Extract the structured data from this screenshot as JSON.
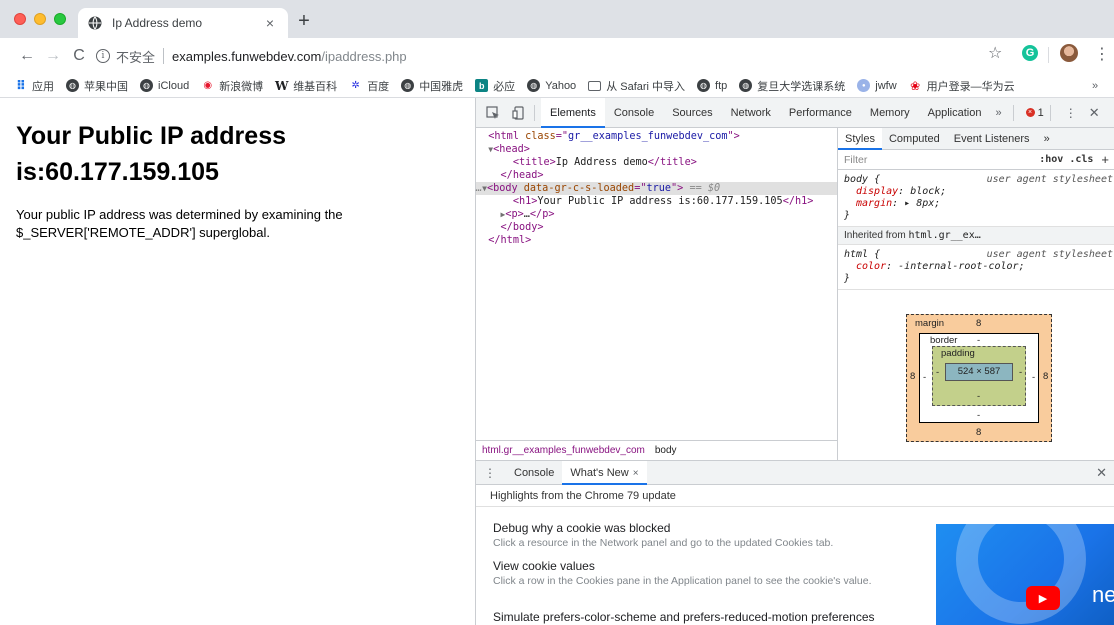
{
  "tab": {
    "title": "Ip Address demo",
    "close": "×",
    "new_tab": "+"
  },
  "toolbar": {
    "back": "←",
    "forward": "→",
    "reload": "C",
    "security_label": "不安全",
    "url_host": "examples.funwebdev.com",
    "url_path": "/ipaddress.php",
    "star": "☆",
    "extension": "G",
    "menu": "⋮"
  },
  "bookmarks": {
    "items": [
      {
        "label": "应用",
        "icon": "apps-icon"
      },
      {
        "label": "苹果中国",
        "icon": "globe-icon"
      },
      {
        "label": "iCloud",
        "icon": "globe-icon"
      },
      {
        "label": "新浪微博",
        "icon": "weibo-icon"
      },
      {
        "label": "维基百科",
        "icon": "wikipedia-icon"
      },
      {
        "label": "百度",
        "icon": "baidu-icon"
      },
      {
        "label": "中国雅虎",
        "icon": "globe-icon"
      },
      {
        "label": "必应",
        "icon": "bing-icon"
      },
      {
        "label": "Yahoo",
        "icon": "globe-icon"
      },
      {
        "label": "从 Safari 中导入",
        "icon": "folder-icon"
      },
      {
        "label": "ftp",
        "icon": "globe-icon"
      },
      {
        "label": "复旦大学选课系统",
        "icon": "globe-icon"
      },
      {
        "label": "jwfw",
        "icon": "jwfw-icon"
      },
      {
        "label": "用户登录—华为云",
        "icon": "huawei-icon"
      }
    ],
    "more": "»"
  },
  "page": {
    "heading": "Your Public IP address is:60.177.159.105",
    "paragraph": "Your public IP address was determined by examining the $_SERVER['REMOTE_ADDR'] superglobal."
  },
  "devtools": {
    "tabs": [
      "Elements",
      "Console",
      "Sources",
      "Network",
      "Performance",
      "Memory",
      "Application"
    ],
    "more": "»",
    "error_count": "1",
    "kebab": "⋮",
    "close": "✕",
    "dom": {
      "html_class": "gr__examples_funwebdev_com",
      "title_text": "Ip Address demo",
      "body_attr_name": "data-gr-c-s-loaded",
      "body_attr_value": "true",
      "selected_marker": "== $0",
      "h1_text": "Your Public IP address is:60.177.159.105"
    },
    "breadcrumb": [
      "html.gr__examples_funwebdev_com",
      "body"
    ],
    "styles": {
      "tabs": [
        "Styles",
        "Computed",
        "Event Listeners",
        "»"
      ],
      "filter_placeholder": "Filter",
      "hov_cls": ":hov .cls",
      "plus": "+",
      "rule1_selector": "body {",
      "rule1_source": "user agent stylesheet",
      "rule1_prop1_name": "display",
      "rule1_prop1_value": "block;",
      "rule1_prop2_name": "margin",
      "rule1_prop2_value": "▸ 8px;",
      "rule_close": "}",
      "inherited_label": "Inherited from",
      "inherited_selector": "html.gr__ex…",
      "rule2_selector": "html {",
      "rule2_source": "user agent stylesheet",
      "rule2_prop1_name": "color",
      "rule2_prop1_value": "-internal-root-color;",
      "box_model": {
        "margin_label": "margin",
        "margin_value": "8",
        "border_label": "border",
        "border_value": "-",
        "padding_label": "padding",
        "padding_value": "-",
        "content_size": "524 × 587",
        "left_margin": "8",
        "right_margin": "8",
        "bottom_margin": "8",
        "left_dash": "-",
        "right_dash": "-",
        "left_pad": "-",
        "right_pad": "-",
        "bottom_pad": "-",
        "bottom_border": "-"
      }
    },
    "drawer": {
      "tabs": [
        "Console",
        "What's New"
      ],
      "tab_close": "×",
      "close": "✕",
      "subtitle": "Highlights from the Chrome 79 update",
      "items": [
        {
          "title": "Debug why a cookie was blocked",
          "desc": "Click a resource in the Network panel and go to the updated Cookies tab."
        },
        {
          "title": "View cookie values",
          "desc": "Click a row in the Cookies pane in the Application panel to see the cookie's value."
        },
        {
          "title": "Simulate prefers-color-scheme and prefers-reduced-motion preferences",
          "desc": ""
        }
      ],
      "art_text": "ne"
    }
  }
}
